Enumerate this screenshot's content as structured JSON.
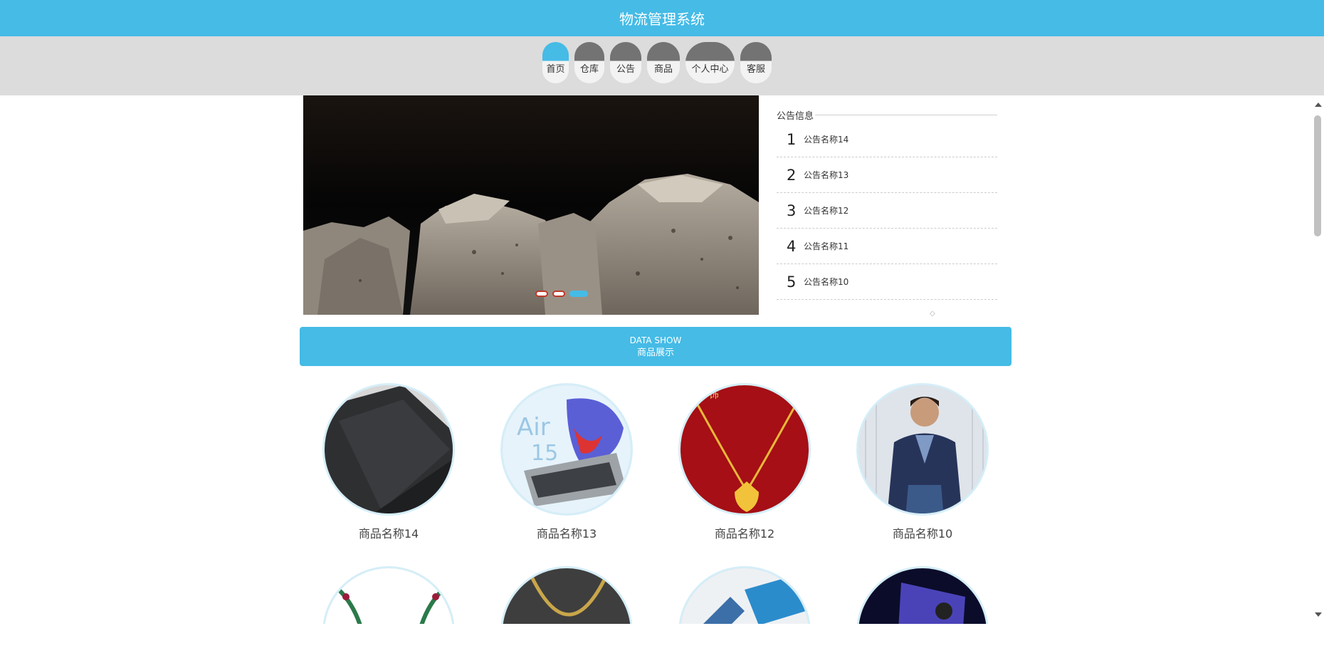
{
  "app": {
    "title": "物流管理系统"
  },
  "nav": {
    "items": [
      {
        "label": "首页",
        "active": true
      },
      {
        "label": "仓库",
        "active": false
      },
      {
        "label": "公告",
        "active": false
      },
      {
        "label": "商品",
        "active": false
      },
      {
        "label": "个人中心",
        "active": false
      },
      {
        "label": "客服",
        "active": false
      }
    ]
  },
  "carousel": {
    "slide_count": 3,
    "active_index": 2
  },
  "notice": {
    "title": "公告信息",
    "items": [
      {
        "num": "1",
        "name": "公告名称14"
      },
      {
        "num": "2",
        "name": "公告名称13"
      },
      {
        "num": "3",
        "name": "公告名称12"
      },
      {
        "num": "4",
        "name": "公告名称11"
      },
      {
        "num": "5",
        "name": "公告名称10"
      }
    ]
  },
  "section": {
    "en": "DATA SHOW",
    "cn": "商品展示"
  },
  "products": {
    "row1": [
      {
        "name": "商品名称14"
      },
      {
        "name": "商品名称13"
      },
      {
        "name": "商品名称12"
      },
      {
        "name": "商品名称10"
      }
    ]
  },
  "colors": {
    "accent": "#45bbe6",
    "nav_bg": "#dcdcdc",
    "nav_cap": "#737373"
  }
}
